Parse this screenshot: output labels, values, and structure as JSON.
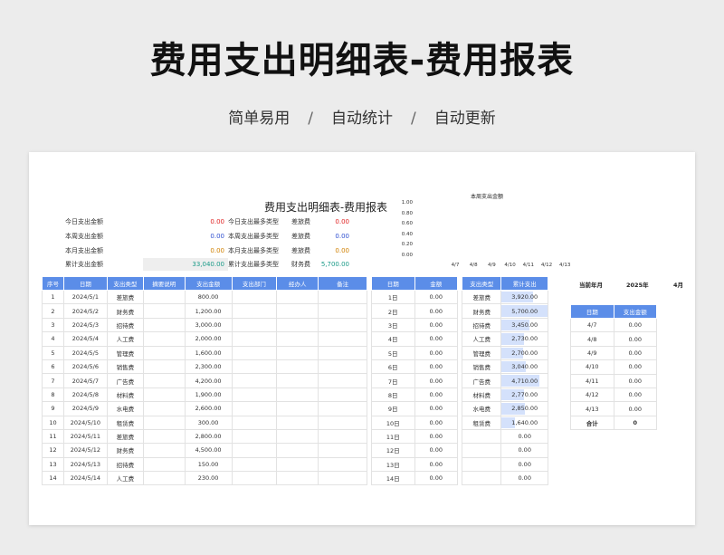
{
  "hero": {
    "title": "费用支出明细表-费用报表",
    "features": [
      "简单易用",
      "自动统计",
      "自动更新"
    ],
    "separator": "/"
  },
  "sheet": {
    "title": "费用支出明细表-费用报表",
    "summary": [
      {
        "label": "今日支出金额",
        "value": "0.00",
        "type_label": "今日支出最多类型",
        "type": "差旅费",
        "type_value": "0.00"
      },
      {
        "label": "本周支出金额",
        "value": "0.00",
        "type_label": "本周支出最多类型",
        "type": "差旅费",
        "type_value": "0.00"
      },
      {
        "label": "本月支出金额",
        "value": "0.00",
        "type_label": "本月支出最多类型",
        "type": "差旅费",
        "type_value": "0.00"
      },
      {
        "label": "累计支出金额",
        "value": "33,040.00",
        "type_label": "累计支出最多类型",
        "type": "财务费",
        "type_value": "5,700.00"
      }
    ],
    "colors": {
      "header_blue": "#5b8de8",
      "red": "#e02020",
      "blue": "#3050d0",
      "orange": "#d08000",
      "teal": "#1a9a88"
    }
  },
  "chart_data": {
    "type": "bar",
    "title": "本周支出金额",
    "categories": [
      "4/7",
      "4/8",
      "4/9",
      "4/10",
      "4/11",
      "4/12",
      "4/13"
    ],
    "values": [
      0,
      0,
      0,
      0,
      0,
      0,
      0
    ],
    "yticks": [
      "1.00",
      "0.80",
      "0.60",
      "0.40",
      "0.20",
      "0.00"
    ],
    "ylim": [
      0,
      1
    ],
    "xlabel": "",
    "ylabel": ""
  },
  "main_table": {
    "headers": [
      "序号",
      "日期",
      "支出类型",
      "摘要说明",
      "支出金额",
      "支出部门",
      "经办人",
      "备注"
    ],
    "rows": [
      [
        "1",
        "2024/5/1",
        "差旅费",
        "",
        "800.00",
        "",
        "",
        ""
      ],
      [
        "2",
        "2024/5/2",
        "财务费",
        "",
        "1,200.00",
        "",
        "",
        ""
      ],
      [
        "3",
        "2024/5/3",
        "招待费",
        "",
        "3,000.00",
        "",
        "",
        ""
      ],
      [
        "4",
        "2024/5/4",
        "人工费",
        "",
        "2,000.00",
        "",
        "",
        ""
      ],
      [
        "5",
        "2024/5/5",
        "管理费",
        "",
        "1,600.00",
        "",
        "",
        ""
      ],
      [
        "6",
        "2024/5/6",
        "销售费",
        "",
        "2,300.00",
        "",
        "",
        ""
      ],
      [
        "7",
        "2024/5/7",
        "广告费",
        "",
        "4,200.00",
        "",
        "",
        ""
      ],
      [
        "8",
        "2024/5/8",
        "材料费",
        "",
        "1,900.00",
        "",
        "",
        ""
      ],
      [
        "9",
        "2024/5/9",
        "水电费",
        "",
        "2,600.00",
        "",
        "",
        ""
      ],
      [
        "10",
        "2024/5/10",
        "租赁费",
        "",
        "300.00",
        "",
        "",
        ""
      ],
      [
        "11",
        "2024/5/11",
        "差旅费",
        "",
        "2,800.00",
        "",
        "",
        ""
      ],
      [
        "12",
        "2024/5/12",
        "财务费",
        "",
        "4,500.00",
        "",
        "",
        ""
      ],
      [
        "13",
        "2024/5/13",
        "招待费",
        "",
        "150.00",
        "",
        "",
        ""
      ],
      [
        "14",
        "2024/5/14",
        "人工费",
        "",
        "230.00",
        "",
        "",
        ""
      ]
    ]
  },
  "daily_table": {
    "headers": [
      "日期",
      "金额"
    ],
    "rows": [
      [
        "1日",
        "0.00"
      ],
      [
        "2日",
        "0.00"
      ],
      [
        "3日",
        "0.00"
      ],
      [
        "4日",
        "0.00"
      ],
      [
        "5日",
        "0.00"
      ],
      [
        "6日",
        "0.00"
      ],
      [
        "7日",
        "0.00"
      ],
      [
        "8日",
        "0.00"
      ],
      [
        "9日",
        "0.00"
      ],
      [
        "10日",
        "0.00"
      ],
      [
        "11日",
        "0.00"
      ],
      [
        "12日",
        "0.00"
      ],
      [
        "13日",
        "0.00"
      ],
      [
        "14日",
        "0.00"
      ]
    ]
  },
  "type_table": {
    "headers": [
      "支出类型",
      "累计支出"
    ],
    "rows": [
      {
        "type": "差旅费",
        "amount": "3,920.00",
        "level": 0.688
      },
      {
        "type": "财务费",
        "amount": "5,700.00",
        "level": 1.0
      },
      {
        "type": "招待费",
        "amount": "3,450.00",
        "level": 0.605
      },
      {
        "type": "人工费",
        "amount": "2,730.00",
        "level": 0.479
      },
      {
        "type": "管理费",
        "amount": "2,700.00",
        "level": 0.474
      },
      {
        "type": "销售费",
        "amount": "3,040.00",
        "level": 0.533
      },
      {
        "type": "广告费",
        "amount": "4,710.00",
        "level": 0.826
      },
      {
        "type": "材料费",
        "amount": "2,770.00",
        "level": 0.486
      },
      {
        "type": "水电费",
        "amount": "2,850.00",
        "level": 0.5
      },
      {
        "type": "租赁费",
        "amount": "1,640.00",
        "level": 0.288
      },
      {
        "type": "",
        "amount": "0.00",
        "level": 0
      },
      {
        "type": "",
        "amount": "0.00",
        "level": 0
      },
      {
        "type": "",
        "amount": "0.00",
        "level": 0
      },
      {
        "type": "",
        "amount": "0.00",
        "level": 0
      }
    ]
  },
  "period": {
    "label": "当前年月",
    "year": "2025年",
    "month": "4月"
  },
  "week_table": {
    "headers": [
      "日期",
      "支出金额"
    ],
    "rows": [
      [
        "4/7",
        "0.00"
      ],
      [
        "4/8",
        "0.00"
      ],
      [
        "4/9",
        "0.00"
      ],
      [
        "4/10",
        "0.00"
      ],
      [
        "4/11",
        "0.00"
      ],
      [
        "4/12",
        "0.00"
      ],
      [
        "4/13",
        "0.00"
      ]
    ],
    "total_label": "合计",
    "total_value": "0"
  }
}
